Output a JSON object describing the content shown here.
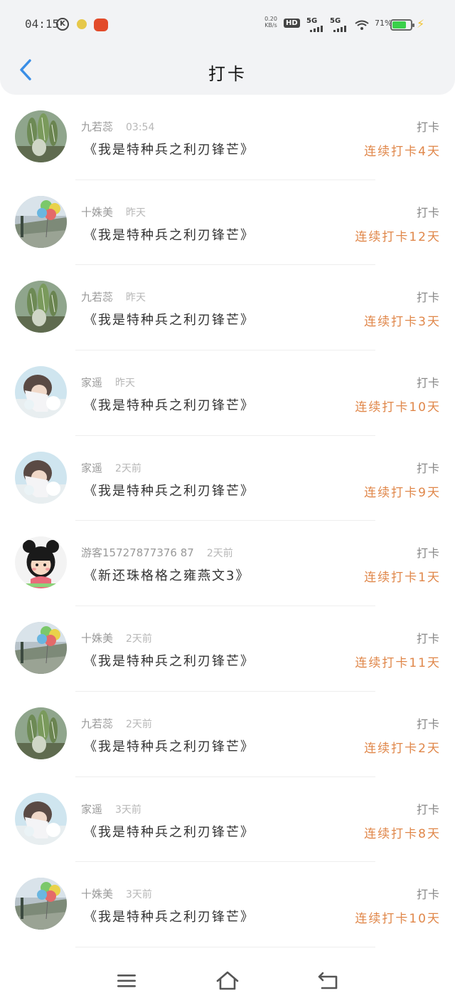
{
  "status_bar": {
    "time": "04:15",
    "k_icon": "K",
    "speed_value": "0.20",
    "speed_unit": "KB/s",
    "hd": "HD",
    "sim1": "5G",
    "sim2": "5G",
    "battery_percent": "71%",
    "battery_level": 0.71
  },
  "header": {
    "title": "打卡"
  },
  "items": [
    {
      "name": "九若蕊",
      "time": "03:54",
      "book": "《我是特种兵之利刃锋芒》",
      "tag": "打卡",
      "streak": "连续打卡4天",
      "avatar": "cactus"
    },
    {
      "name": "十姝美",
      "time": "昨天",
      "book": "《我是特种兵之利刃锋芒》",
      "tag": "打卡",
      "streak": "连续打卡12天",
      "avatar": "balloon"
    },
    {
      "name": "九若蕊",
      "time": "昨天",
      "book": "《我是特种兵之利刃锋芒》",
      "tag": "打卡",
      "streak": "连续打卡3天",
      "avatar": "cactus"
    },
    {
      "name": "家遥",
      "time": "昨天",
      "book": "《我是特种兵之利刃锋芒》",
      "tag": "打卡",
      "streak": "连续打卡10天",
      "avatar": "girl"
    },
    {
      "name": "家遥",
      "time": "2天前",
      "book": "《我是特种兵之利刃锋芒》",
      "tag": "打卡",
      "streak": "连续打卡9天",
      "avatar": "girl"
    },
    {
      "name": "游客15727877376 87",
      "time": "2天前",
      "book": "《新还珠格格之雍燕文3》",
      "tag": "打卡",
      "streak": "连续打卡1天",
      "avatar": "cartoon"
    },
    {
      "name": "十姝美",
      "time": "2天前",
      "book": "《我是特种兵之利刃锋芒》",
      "tag": "打卡",
      "streak": "连续打卡11天",
      "avatar": "balloon"
    },
    {
      "name": "九若蕊",
      "time": "2天前",
      "book": "《我是特种兵之利刃锋芒》",
      "tag": "打卡",
      "streak": "连续打卡2天",
      "avatar": "cactus"
    },
    {
      "name": "家遥",
      "time": "3天前",
      "book": "《我是特种兵之利刃锋芒》",
      "tag": "打卡",
      "streak": "连续打卡8天",
      "avatar": "girl"
    },
    {
      "name": "十姝美",
      "time": "3天前",
      "book": "《我是特种兵之利刃锋芒》",
      "tag": "打卡",
      "streak": "连续打卡10天",
      "avatar": "balloon"
    }
  ],
  "nav": {
    "menu_icon": "menu-icon",
    "home_icon": "home-icon",
    "back_icon": "back-icon"
  },
  "colors": {
    "accent_blue": "#3a8ee6",
    "streak_orange": "#e0874a",
    "battery_green": "#3ad04a"
  }
}
